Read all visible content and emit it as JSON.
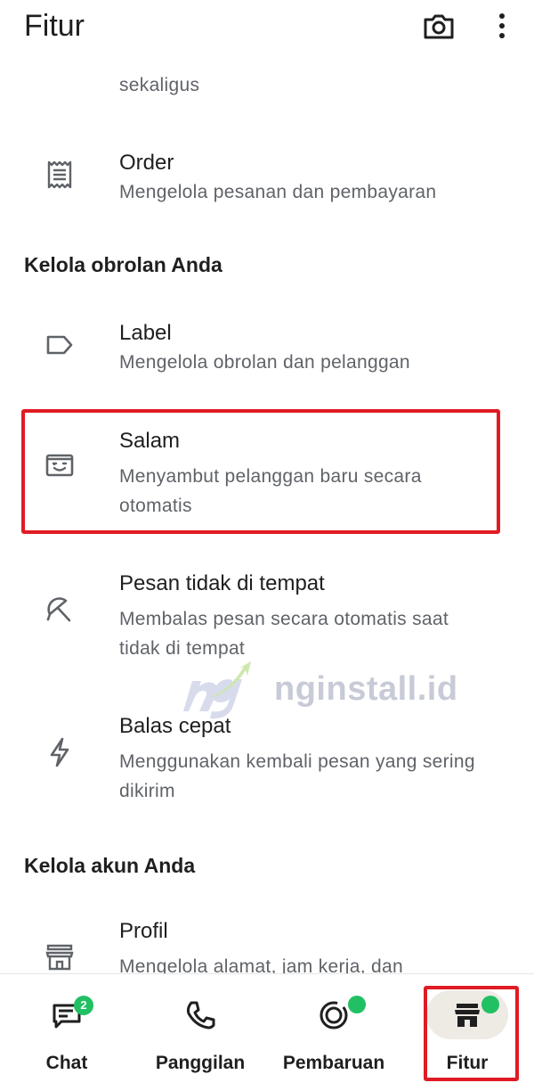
{
  "header": {
    "title": "Fitur"
  },
  "content": {
    "partial_sub": "sekaligus",
    "order": {
      "title": "Order",
      "sub": "Mengelola pesanan dan pembayaran"
    },
    "section_chats": "Kelola obrolan Anda",
    "label": {
      "title": "Label",
      "sub": "Mengelola obrolan dan pelanggan"
    },
    "greeting": {
      "title": "Salam",
      "sub": "Menyambut pelanggan baru secara otomatis"
    },
    "away": {
      "title": "Pesan tidak di tempat",
      "sub": "Membalas pesan secara otomatis saat tidak di tempat"
    },
    "quick": {
      "title": "Balas cepat",
      "sub": "Menggunakan kembali pesan yang sering dikirim"
    },
    "section_account": "Kelola akun Anda",
    "profile": {
      "title": "Profil",
      "sub": "Mengelola alamat, jam kerja, dan"
    }
  },
  "watermark": {
    "text": "nginstall.id"
  },
  "nav": {
    "items": [
      {
        "label": "Chat",
        "badge": "2"
      },
      {
        "label": "Panggilan"
      },
      {
        "label": "Pembaruan"
      },
      {
        "label": "Fitur"
      }
    ]
  },
  "colors": {
    "accent": "#21c063",
    "highlight": "#e01b24",
    "muted": "#5f6368"
  },
  "icons": [
    "camera-icon",
    "more-vert-icon",
    "receipt-icon",
    "label-icon",
    "greeting-icon",
    "away-icon",
    "bolt-icon",
    "store-icon",
    "chat-icon",
    "phone-icon",
    "updates-icon"
  ]
}
